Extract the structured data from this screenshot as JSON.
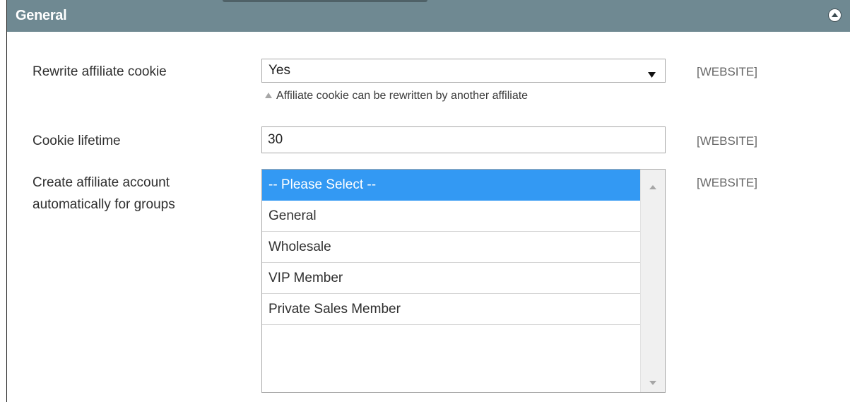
{
  "section": {
    "title": "General"
  },
  "fields": {
    "rewrite_cookie": {
      "label": "Rewrite affiliate cookie",
      "value": "Yes",
      "note": "Affiliate cookie can be rewritten by another affiliate",
      "scope": "[WEBSITE]"
    },
    "cookie_lifetime": {
      "label": "Cookie lifetime",
      "value": "30",
      "scope": "[WEBSITE]"
    },
    "auto_groups": {
      "label_line1": "Create affiliate account",
      "label_line2": "automatically for groups",
      "options": [
        "-- Please Select --",
        "General",
        "Wholesale",
        "VIP Member",
        "Private Sales Member"
      ],
      "selected": "-- Please Select --",
      "scope": "[WEBSITE]"
    }
  },
  "colors": {
    "header_bg": "#6f8992",
    "selected_option_bg": "#3399f3"
  },
  "icons": {
    "collapse": "collapse-up-icon",
    "dropdown": "dropdown-arrow-icon",
    "note": "note-triangle-icon",
    "scroll_up": "scroll-up-arrow-icon",
    "scroll_down": "scroll-down-arrow-icon"
  }
}
